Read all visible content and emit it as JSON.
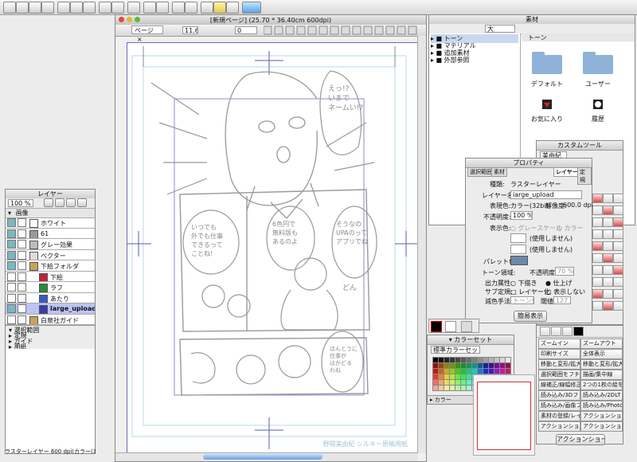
{
  "window": {
    "title": "[新規ページ] (25.70 * 36.40cm 600dpi)",
    "tab": "ページ",
    "tab_close": "×",
    "zoom": "11.6",
    "rotation": "0"
  },
  "layers": {
    "title": "レイヤー",
    "opacity": "100 %",
    "group_images": "画像",
    "items": [
      {
        "name": "ホワイト",
        "swatch": "#ffffff"
      },
      {
        "name": "61",
        "swatch": "#999999"
      },
      {
        "name": "グレー効果",
        "swatch": "#bbbbbb"
      },
      {
        "name": "ベクター",
        "swatch": "#dddddd"
      },
      {
        "name": "下絵フォルダ",
        "swatch": "#c8a35c"
      },
      {
        "name": "下絵",
        "swatch": "#c0233b"
      },
      {
        "name": "ラフ",
        "swatch": "#2a8a3a"
      },
      {
        "name": "あたり",
        "swatch": "#3a5abf"
      },
      {
        "name": "large_upload",
        "swatch": "#3a3aa8"
      },
      {
        "name": "白泉社ガイド",
        "swatch": "#c8a35c"
      }
    ],
    "bottom": [
      "選択範囲",
      "定規",
      "ガイド",
      "用紙"
    ]
  },
  "material": {
    "title": "素材",
    "size": "大",
    "header": "トーン",
    "tree": [
      "トーン",
      "マテリアル",
      "追加素材",
      "外部参照"
    ],
    "items": [
      "デフォルト",
      "ユーザー",
      "お気に入り",
      "履歴"
    ]
  },
  "custom_tool": {
    "title": "カスタムツール",
    "field": "美由紀"
  },
  "property": {
    "title": "プロパティ",
    "tabs": [
      "選択範囲",
      "素材",
      "レイヤー",
      "定規"
    ],
    "kind_label": "種類:",
    "kind": "ラスターレイヤー",
    "name_label": "レイヤー名:",
    "name": "large_upload",
    "color_label": "表現色:",
    "color": "カラー(32bit)",
    "res_label": "解像度:",
    "res": "600.0 dpi",
    "opacity_label": "不透明度:",
    "opacity": "100 %",
    "display_label": "表示色:",
    "grayscale": "グレースケール",
    "color_opt": "カラー",
    "unused1": "(使用しません)",
    "unused2": "(使用しません)",
    "palette_label": "パレット色:",
    "tone_label": "トーン領域:",
    "tone_opacity_label": "不透明度:",
    "tone_opacity": "70 %",
    "output_label": "出力属性:",
    "sketch": "下描き",
    "finish": "仕上げ",
    "sub_label": "サブ定規:",
    "layerize": "レイヤー化",
    "hide": "表示しない",
    "reduce_label": "減色手法:",
    "reduce": "トーン化",
    "threshold_label": "閾値:",
    "threshold": "127",
    "simple_button": "簡易表示"
  },
  "color_set": {
    "title": "カラーセット",
    "set_name": "標準カラーセット",
    "sub_title": "カラー"
  },
  "actions": {
    "title": "アクションショート",
    "items": [
      "ズームイン",
      "ズームアウト",
      "印刷サイズ",
      "全体表示",
      "移動と変形/拡大・",
      "移動と変形/拡大・",
      "選択範囲をフチ取り",
      "描画/集中線",
      "線補正/線幅修正",
      "2つの1枚の絵を",
      "読み込み/3Dファイ",
      "読み込み/2DLT",
      "読み込み/画像ファ",
      "読み込み/Photosh",
      "素材の登録/レイヤ",
      "アクションショート",
      "アクションショート",
      "アクションショート"
    ],
    "footer": "アクションショート"
  },
  "manga": {
    "bubble1": "えっ!?\nいまで\nネームい!?",
    "bubble2": "そうなの\nUPAのって\nアプリでね",
    "bubble3": "6色円で\n無料版も\nあるのよ",
    "bubble4": "いつでも\n外でも仕事\nできるって\nことね!",
    "bubble5": "ほんとうに\n仕事が\nはかどる\nわね",
    "sound": "どん",
    "credit": "野間美由紀 シルキー原稿用紙"
  },
  "status": "ラスターレイヤー 600 dpi(カラー(32bit..."
}
